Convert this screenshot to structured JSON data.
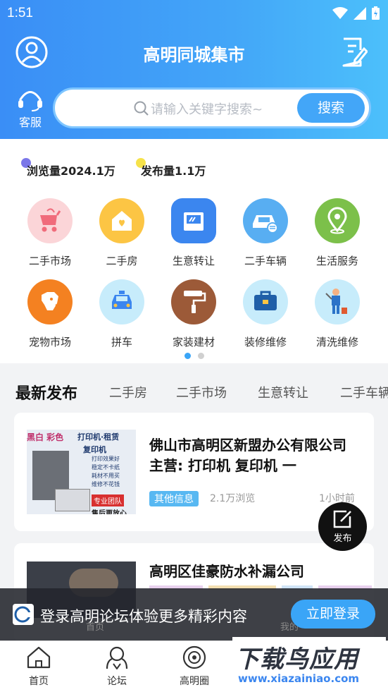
{
  "status_bar": {
    "time": "1:51"
  },
  "header": {
    "title": "高明同城集市",
    "service_label": "客服"
  },
  "search": {
    "placeholder": "请输入关键字搜索~",
    "button": "搜索"
  },
  "stats": {
    "views": "浏览量2024.1万",
    "posts": "发布量1.1万"
  },
  "categories": [
    {
      "label": "二手市场",
      "icon": "stroller-icon",
      "color": "#fbd5d8"
    },
    {
      "label": "二手房",
      "icon": "house-icon",
      "color": "#fcc544"
    },
    {
      "label": "生意转让",
      "icon": "shop-icon",
      "color": "#3b86ef"
    },
    {
      "label": "二手车辆",
      "icon": "car-icon",
      "color": "#58aef2"
    },
    {
      "label": "生活服务",
      "icon": "location-pin-icon",
      "color": "#7cc04a"
    },
    {
      "label": "宠物市场",
      "icon": "dog-icon",
      "color": "#f48121"
    },
    {
      "label": "拼车",
      "icon": "taxi-icon",
      "color": "#c7ecfb"
    },
    {
      "label": "家装建材",
      "icon": "paint-roller-icon",
      "color": "#9c5a38"
    },
    {
      "label": "装修维修",
      "icon": "toolbox-icon",
      "color": "#c7ecfb"
    },
    {
      "label": "清洗维修",
      "icon": "cleaner-icon",
      "color": "#c7ecfb"
    }
  ],
  "pager": {
    "active": 1,
    "total": 2
  },
  "feed_tabs": [
    "最新发布",
    "二手房",
    "二手市场",
    "生意转让",
    "二手车辆"
  ],
  "posts": [
    {
      "title": "佛山市高明区新盟办公有限公司 主营: 打印机 复印机 一",
      "tag": "其他信息",
      "views": "2.1万浏览",
      "time": "1小时前",
      "thumb_texts": [
        "黑白 彩色",
        "打印机·租赁",
        "复印机",
        "打印效果好",
        "稳定不卡纸",
        "耗材不用买",
        "维修不花钱",
        "专业团队",
        "售后更放心"
      ]
    },
    {
      "title": "高明区佳豪防水补漏公司"
    }
  ],
  "fab": {
    "label": "发布"
  },
  "banner": {
    "text": "登录高明论坛体验更多精彩内容",
    "button": "立即登录",
    "peek_home": "首页",
    "peek_me": "我的"
  },
  "bottom_nav": [
    "首页",
    "论坛",
    "高明圈"
  ],
  "watermark": {
    "text": "下载鸟应用",
    "url": "www.xiazainiao.com"
  },
  "colors": {
    "primary": "#43a6f8",
    "dark_banner": "#23262c"
  }
}
